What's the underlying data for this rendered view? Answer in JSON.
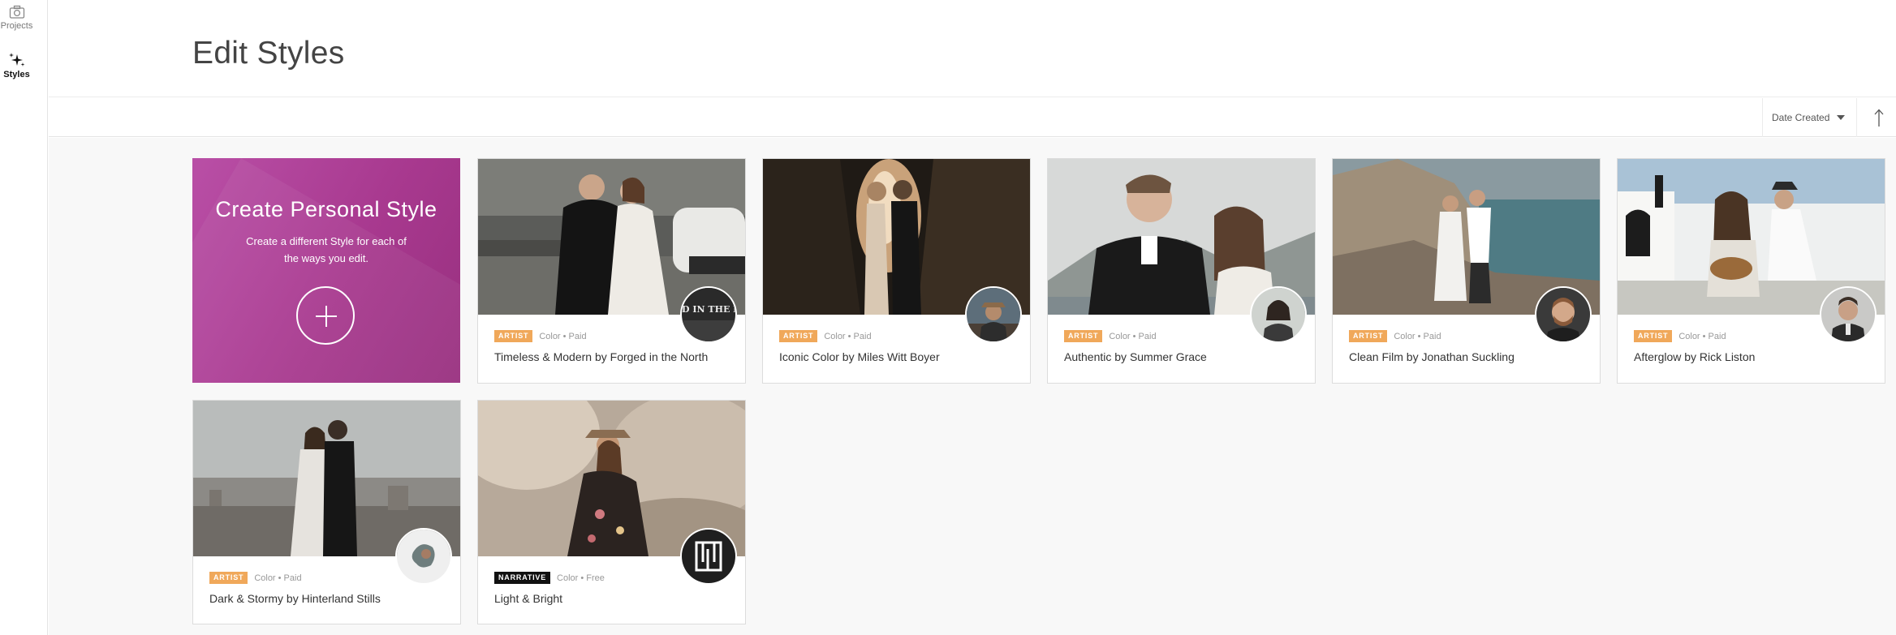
{
  "sidebar": {
    "items": [
      {
        "label": "Projects",
        "icon": "camera-icon"
      },
      {
        "label": "Styles",
        "icon": "sparkle-icon"
      }
    ]
  },
  "header": {
    "title": "Edit Styles"
  },
  "toolbar": {
    "sort_label": "Date Created",
    "sort_direction": "ascending"
  },
  "create_card": {
    "title": "Create Personal Style",
    "description": "Create a different Style for each of the ways you edit."
  },
  "styles": [
    {
      "badge": "ARTIST",
      "meta": "Color • Paid",
      "title": "Timeless & Modern by Forged in the North"
    },
    {
      "badge": "ARTIST",
      "meta": "Color • Paid",
      "title": "Iconic Color by Miles Witt Boyer"
    },
    {
      "badge": "ARTIST",
      "meta": "Color • Paid",
      "title": "Authentic by Summer Grace"
    },
    {
      "badge": "ARTIST",
      "meta": "Color • Paid",
      "title": "Clean Film by Jonathan Suckling"
    },
    {
      "badge": "ARTIST",
      "meta": "Color • Paid",
      "title": "Afterglow by Rick Liston"
    },
    {
      "badge": "ARTIST",
      "meta": "Color • Paid",
      "title": "Dark & Stormy by Hinterland Stills"
    },
    {
      "badge": "NARRATIVE",
      "meta": "Color • Free",
      "title": "Light & Bright"
    }
  ],
  "avatar_texts": {
    "forged_logo": "FORGED IN THE NORTH"
  },
  "colors": {
    "accent_create": "#a8398f",
    "artist_badge": "#f0a85a",
    "narrative_badge": "#111111"
  }
}
